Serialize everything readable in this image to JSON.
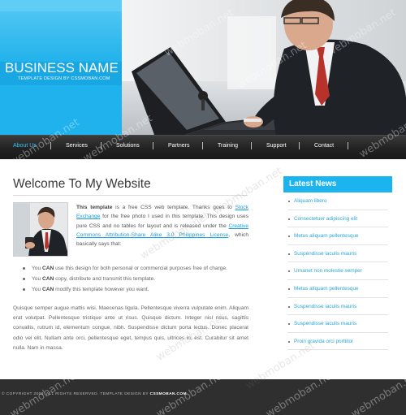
{
  "brand": {
    "name": "BUSINESS NAME",
    "tagline": "TEMPLATE DESIGN BY CSSMOBAN.COM"
  },
  "nav": {
    "items": [
      {
        "label": "About Us",
        "active": true
      },
      {
        "label": "Services"
      },
      {
        "label": "Solutions"
      },
      {
        "label": "Partners"
      },
      {
        "label": "Training"
      },
      {
        "label": "Support"
      },
      {
        "label": "Contact"
      }
    ]
  },
  "main": {
    "title": "Welcome To My Website",
    "intro": {
      "lead_bold": "This template",
      "part1": " is a free CSS web template. Thanks goes to ",
      "link1": "Stock Exchange",
      "part2": " for the free photo I used in this template. This design uses pure CSS and no tables for layout and is released under the ",
      "link2": "Creative Commons Attribution-Share Alike 3.0 Philippines License",
      "part3": ", which basically says that:"
    },
    "bullets": [
      {
        "pre": "You ",
        "bold": "CAN",
        "post": " use this design for both personal or commercial purposes free of charge."
      },
      {
        "pre": "You ",
        "bold": "CAN",
        "post": " copy, distribute and transmit this template."
      },
      {
        "pre": "You ",
        "bold": "CAN",
        "post": " modify this template however you want."
      }
    ],
    "paragraph": "Quisque semper augue mattis wisi. Maecenas ligula. Pellentesque viverra vulputate enim. Aliquam erat volutpat. Pellentesque tristique ante ut risus. Quisque dictum. Integer nisl risus, sagittis convallis, rutrum id, elementum congue, nibh. Suspendisse dictum porta lectus. Donec placerat odio vel elit. Nullam ante orci, pellentesque eget, tempus quis, ultrices in, est. Curabitur sit amet nulla. Nam in massa."
  },
  "sidebar": {
    "heading": "Latest News",
    "items": [
      "Aliquam libero",
      "Consectetuer adipiscing elit",
      "Metus aliquam pellentesque",
      "Suspendisse iaculis mauris",
      "Urnanet non molestie semper",
      "Metus aliquam pellentesque",
      "Suspendisse iaculis mauris",
      "Suspendisse iaculis mauris",
      "Proin gravida orci porttitor"
    ]
  },
  "footer": {
    "text": "© COPYRIGHT 2009. ALL RIGHTS RESERVED. TEMPLATE DESIGN BY ",
    "brand": "CSSMOBAN.COM"
  },
  "watermark": "webmoban.net",
  "colors": {
    "accent": "#1cb4ee",
    "nav_bg": "#222222",
    "footer_bg": "#2f2f2f",
    "link": "#28a6dc"
  }
}
